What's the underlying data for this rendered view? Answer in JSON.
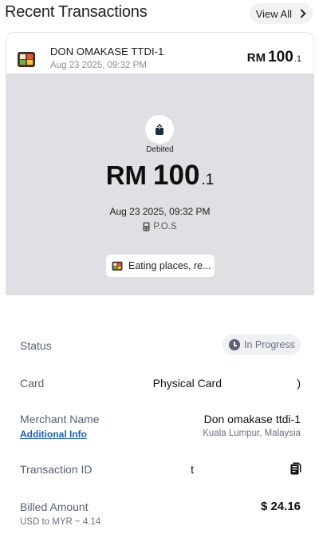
{
  "header": {
    "title": "Recent Transactions",
    "view_all_label": "View All",
    "view_all_icon": "chevron-right-icon"
  },
  "transaction": {
    "merchant_display": "DON OMAKASE TTDI-1",
    "datetime": "Aug 23 2025, 09:32 PM",
    "currency": "RM",
    "amount_int": "100",
    "amount_dec": ".1",
    "merchant_icon": "bento-box-icon"
  },
  "detail": {
    "direction_label": "Debited",
    "direction_icon": "upload-arrow-icon",
    "currency": "RM",
    "amount_int": "100",
    "amount_dec": ".1",
    "datetime": "Aug 23 2025, 09:32 PM",
    "channel": "P.O.S",
    "channel_icon": "card-terminal-icon",
    "category": "Eating places, re...",
    "category_icon": "bento-box-icon"
  },
  "rows": {
    "status_label": "Status",
    "status_value": "In Progress",
    "card_label": "Card",
    "card_value": "Physical Card",
    "card_suffix": ")",
    "merchant_label": "Merchant Name",
    "merchant_value": "Don omakase ttdi-1",
    "additional_info": "Additional Info",
    "merchant_location": "Kuala Lumpur, Malaysia",
    "txn_id_label": "Transaction ID",
    "txn_id_value": "t",
    "billed_label": "Billed Amount",
    "billed_value": "$ 24.16",
    "fx_rate": "USD to MYR ~ 4.14"
  },
  "colors": {
    "panel_bg": "#dfe0e3",
    "link": "#1f5fb5",
    "muted": "#586173"
  }
}
